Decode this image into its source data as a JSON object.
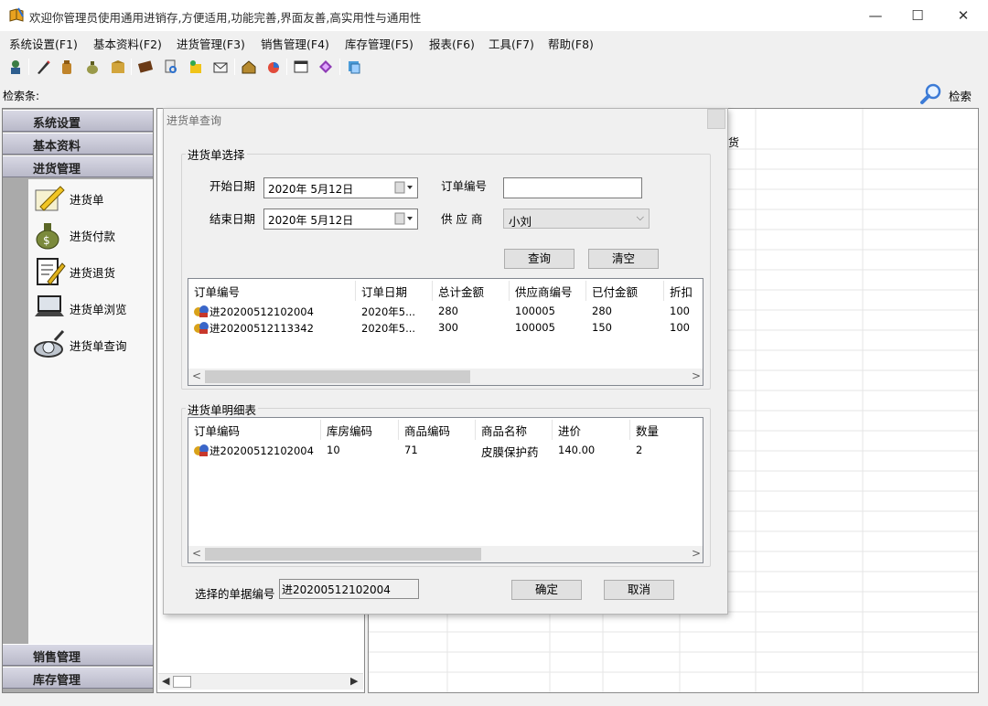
{
  "window": {
    "title": "欢迎你管理员使用通用进销存,方便适用,功能完善,界面友善,高实用性与通用性",
    "minimize": "—",
    "maximize": "☐",
    "close": "✕"
  },
  "menu": [
    {
      "label": "系统设置(F1)"
    },
    {
      "label": "基本资料(F2)"
    },
    {
      "label": "进货管理(F3)"
    },
    {
      "label": "销售管理(F4)"
    },
    {
      "label": "库存管理(F5)"
    },
    {
      "label": "报表(F6)"
    },
    {
      "label": "工具(F7)"
    },
    {
      "label": "帮助(F8)"
    }
  ],
  "toolbar": {
    "icons": [
      "user-icon",
      "pen-icon",
      "bag-icon",
      "money-bag-icon",
      "box-icon",
      "book-icon",
      "search-doc-icon",
      "package-icon",
      "mail-icon",
      "house-icon",
      "chart-icon",
      "window-icon",
      "palette-icon",
      "stack-icon"
    ]
  },
  "searchbar": {
    "label": "检索条:",
    "button": "检索"
  },
  "sidebar": {
    "groups": [
      {
        "label": "系统设置"
      },
      {
        "label": "基本资料"
      },
      {
        "label": "进货管理"
      }
    ],
    "items": [
      {
        "label": "进货单",
        "icon": "pen-paper-icon"
      },
      {
        "label": "进货付款",
        "icon": "money-bag-icon"
      },
      {
        "label": "进货退货",
        "icon": "notepad-icon"
      },
      {
        "label": "进货单浏览",
        "icon": "laptop-icon"
      },
      {
        "label": "进货单查询",
        "icon": "magnifier-icon"
      }
    ],
    "bottom_groups": [
      {
        "label": "销售管理"
      },
      {
        "label": "库存管理"
      }
    ]
  },
  "background_pane": {
    "partial_text": "货"
  },
  "dialog": {
    "title": "进货单查询",
    "select_group": "进货单选择",
    "start_date_label": "开始日期",
    "start_date": "2020年  5月12日",
    "end_date_label": "结束日期",
    "end_date": "2020年  5月12日",
    "order_no_label": "订单编号",
    "order_no_value": "",
    "supplier_label": "供 应 商",
    "supplier_value": "小刘",
    "query_button": "查询",
    "clear_button": "清空",
    "orders": {
      "columns": [
        "订单编号",
        "订单日期",
        "总计金额",
        "供应商编号",
        "已付金额",
        "折扣"
      ],
      "rows": [
        [
          "进20200512102004",
          "2020年5...",
          "280",
          "100005",
          "280",
          "100"
        ],
        [
          "进20200512113342",
          "2020年5...",
          "300",
          "100005",
          "150",
          "100"
        ]
      ]
    },
    "detail_group": "进货单明细表",
    "details": {
      "columns": [
        "订单编码",
        "库房编码",
        "商品编码",
        "商品名称",
        "进价",
        "数量"
      ],
      "rows": [
        [
          "进20200512102004",
          "10",
          "71",
          "皮膜保护药",
          "140.00",
          "2"
        ]
      ]
    },
    "selected_label": "选择的单据编号",
    "selected_value": "进20200512102004",
    "ok_button": "确定",
    "cancel_button": "取消"
  }
}
